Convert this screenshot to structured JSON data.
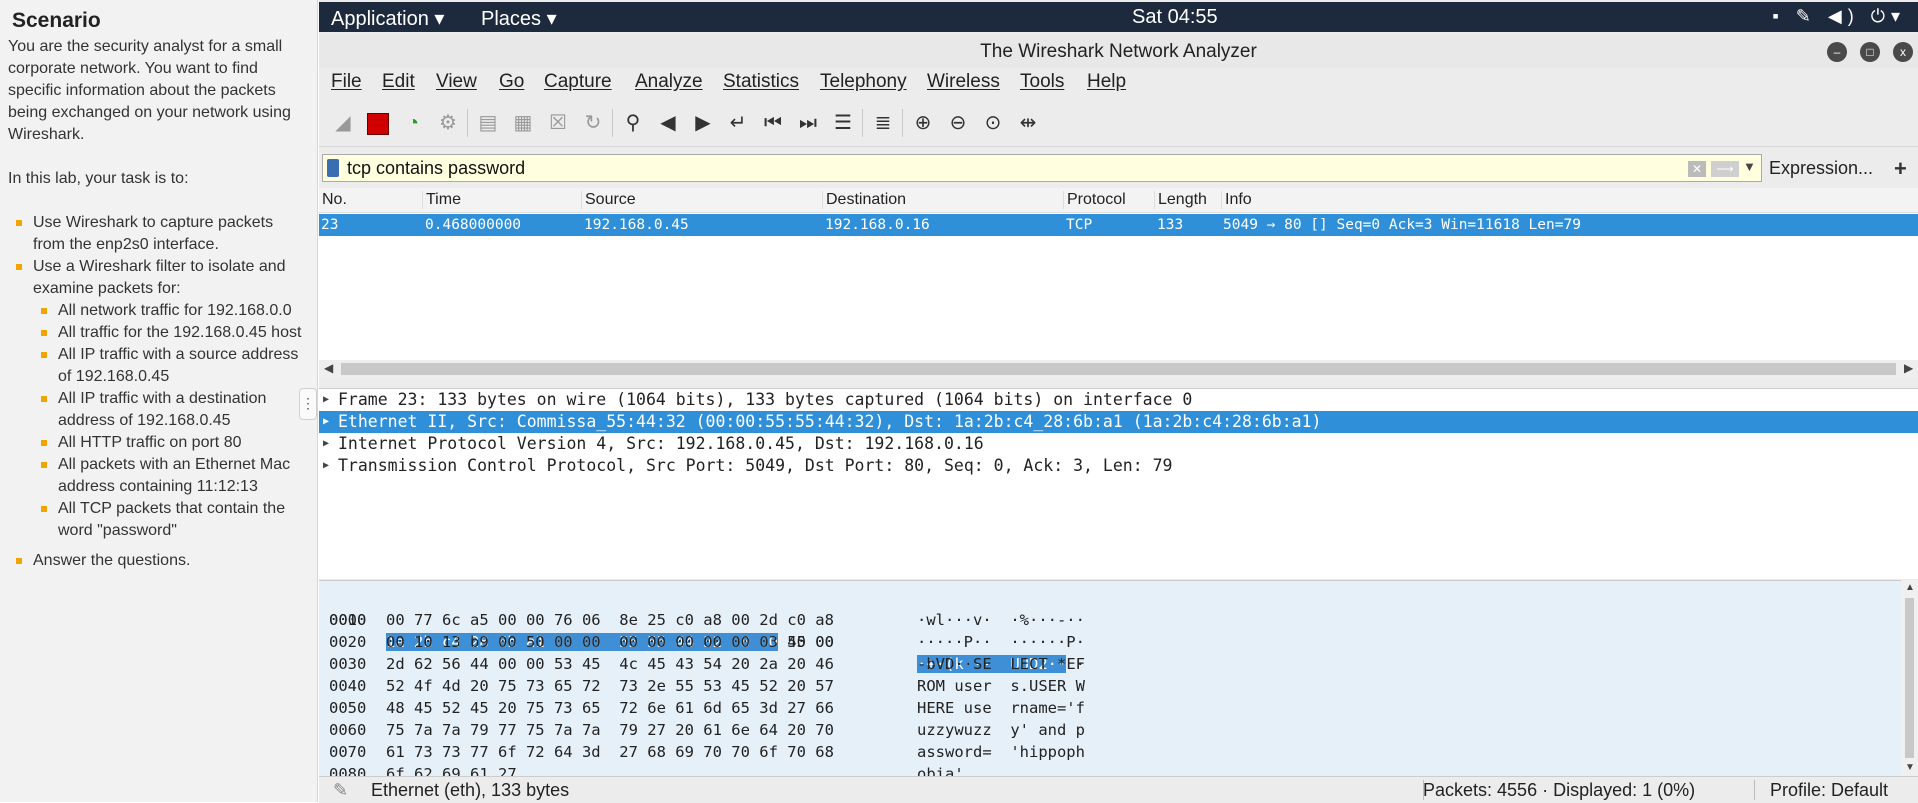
{
  "scenario": {
    "heading": "Scenario",
    "intro": "You are the security analyst for a small corporate network. You want to find specific information about the packets being exchanged on your network using Wireshark.",
    "task_intro": "In this lab, your task is to:",
    "tasks": [
      "Use Wireshark to capture packets from the enp2s0 interface.",
      "Use a Wireshark filter to isolate and examine packets for:"
    ],
    "subtasks": [
      "All network traffic for 192.168.0.0",
      "All traffic for the 192.168.0.45 host",
      "All IP traffic with a source address of 192.168.0.45",
      "All IP traffic with a destination address of 192.168.0.45",
      "All HTTP traffic on port 80",
      "All packets with an Ethernet Mac address containing 11:12:13",
      "All TCP packets that contain the word \"password\""
    ],
    "final_task": "Answer the questions."
  },
  "topbar": {
    "application": "Application ▾",
    "places": "Places ▾",
    "clock": "Sat 04:55"
  },
  "window": {
    "title": "The Wireshark Network Analyzer"
  },
  "menu": [
    "File",
    "Edit",
    "View",
    "Go",
    "Capture",
    "Analyze",
    "Statistics",
    "Telephony",
    "Wireless",
    "Tools",
    "Help"
  ],
  "filter": {
    "value": "tcp contains password",
    "expression_label": "Expression...",
    "add_label": "+"
  },
  "packet_list": {
    "columns": [
      "No.",
      "Time",
      "Source",
      "Destination",
      "Protocol",
      "Length",
      "Info"
    ],
    "rows": [
      {
        "no": "23",
        "time": "0.468000000",
        "source": "192.168.0.45",
        "destination": "192.168.0.16",
        "protocol": "TCP",
        "length": "133",
        "info": "5049 → 80 [] Seq=0 Ack=3 Win=11618 Len=79"
      }
    ]
  },
  "details": [
    "Frame 23: 133 bytes on wire (1064 bits), 133 bytes captured (1064 bits) on interface 0",
    "Ethernet II, Src: Commissa_55:44:32 (00:00:55:55:44:32), Dst: 1a:2b:c4_28:6b:a1 (1a:2b:c4:28:6b:a1)",
    "Internet Protocol Version 4, Src: 192.168.0.45, Dst: 192.168.0.16",
    "Transmission Control Protocol, Src Port: 5049, Dst Port: 80, Seq: 0, Ack: 3, Len: 79"
  ],
  "bytes": [
    {
      "off": "0000",
      "hex_hl": "1a 2b c4 28 6b a1 00 00  55 55 44 32 08 00",
      "hex_rest": " 45 00",
      "asc_hl": "·+·(k···  UUD2··",
      "asc_rest": "E·"
    },
    {
      "off": "0010",
      "hex": "00 77 6c a5 00 00 76 06  8e 25 c0 a8 00 2d c0 a8",
      "asc": "·wl···v·  ·%···-··"
    },
    {
      "off": "0020",
      "hex": "00 10 13 b9 00 50 00 00  00 00 00 00 00 03 50 00",
      "asc": "·····P··  ······P·"
    },
    {
      "off": "0030",
      "hex": "2d 62 56 44 00 00 53 45  4c 45 43 54 20 2a 20 46",
      "asc": "-bVD··SE  LECT * F"
    },
    {
      "off": "0040",
      "hex": "52 4f 4d 20 75 73 65 72  73 2e 55 53 45 52 20 57",
      "asc": "ROM user  s.USER W"
    },
    {
      "off": "0050",
      "hex": "48 45 52 45 20 75 73 65  72 6e 61 6d 65 3d 27 66",
      "asc": "HERE use  rname='f"
    },
    {
      "off": "0060",
      "hex": "75 7a 7a 79 77 75 7a 7a  79 27 20 61 6e 64 20 70",
      "asc": "uzzywuzz  y' and p"
    },
    {
      "off": "0070",
      "hex": "61 73 73 77 6f 72 64 3d  27 68 69 70 70 6f 70 68",
      "asc": "assword=  'hippoph"
    },
    {
      "off": "0080",
      "hex": "6f 62 69 61 27",
      "asc": "obia'"
    }
  ],
  "status": {
    "left": "Ethernet (eth), 133 bytes",
    "packets": "Packets: 4556 · Displayed: 1 (0%)",
    "profile": "Profile: Default"
  }
}
